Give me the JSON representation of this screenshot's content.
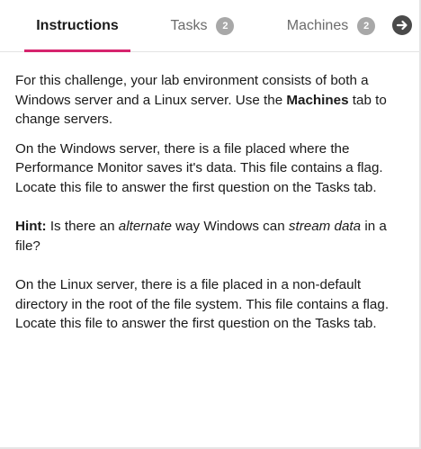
{
  "tabs": {
    "instructions": {
      "label": "Instructions"
    },
    "tasks": {
      "label": "Tasks",
      "count": "2"
    },
    "machines": {
      "label": "Machines",
      "count": "2"
    },
    "next_icon": "arrow-right-circle"
  },
  "colors": {
    "accent": "#d6246e",
    "badge": "#a8a8a8",
    "arrow_bg": "#4a4a4a"
  },
  "content": {
    "p1": {
      "t1": "For this challenge, your lab environment consists of both a Windows server and a Linux server. Use the ",
      "bold": "Machines",
      "t2": " tab to change servers."
    },
    "p2": "On the Windows server, there is a file placed where the Performance Monitor saves it's data. This file contains a flag. Locate this file to answer the first question on the Tasks tab.",
    "p3": {
      "hint_label": "Hint:",
      "t1": " Is there an ",
      "italic1": "alternate",
      "t2": " way Windows can ",
      "italic2": "stream data",
      "t3": " in a file?"
    },
    "p4": "On the Linux server, there is a file placed in a non-default directory in the root of the file system. This file contains a flag. Locate this file to answer the first question on the Tasks tab."
  }
}
